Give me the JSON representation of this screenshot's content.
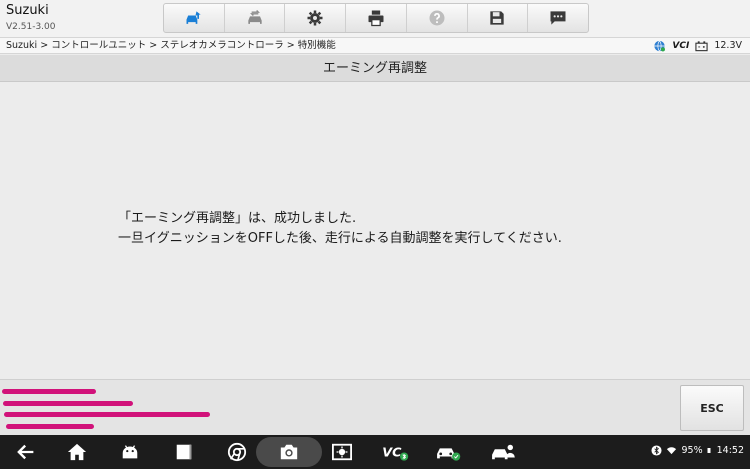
{
  "app": {
    "title": "Suzuki",
    "version": "V2.51-3.00"
  },
  "toolbar": {
    "buttons": [
      {
        "icon": "car-home-icon",
        "color": "#1a7fd6"
      },
      {
        "icon": "car-switch-icon"
      },
      {
        "icon": "gear-icon"
      },
      {
        "icon": "printer-icon"
      },
      {
        "icon": "help-icon"
      },
      {
        "icon": "save-icon"
      },
      {
        "icon": "message-icon"
      }
    ]
  },
  "breadcrumb": {
    "text": "Suzuki > コントロールユニット > ステレオカメラコントローラ > 特別機能"
  },
  "status": {
    "vci_label": "VCI",
    "voltage": "12.3V"
  },
  "function_title": "エーミング再調整",
  "message": {
    "line1": "「エーミング再調整」は、成功しました.",
    "line2": "一旦イグニッションをOFFした後、走行による自動調整を実行してください."
  },
  "actions": {
    "esc_label": "ESC"
  },
  "redaction_color": "#d1127a",
  "navbar": {
    "battery": "95%",
    "time": "14:52",
    "icons": [
      "back-icon",
      "home-icon",
      "android-icon",
      "recents-icon",
      "chrome-icon",
      "camera-icon",
      "screenshot-icon",
      "vci-bt-icon",
      "car-diag-icon",
      "car-user-icon"
    ]
  }
}
